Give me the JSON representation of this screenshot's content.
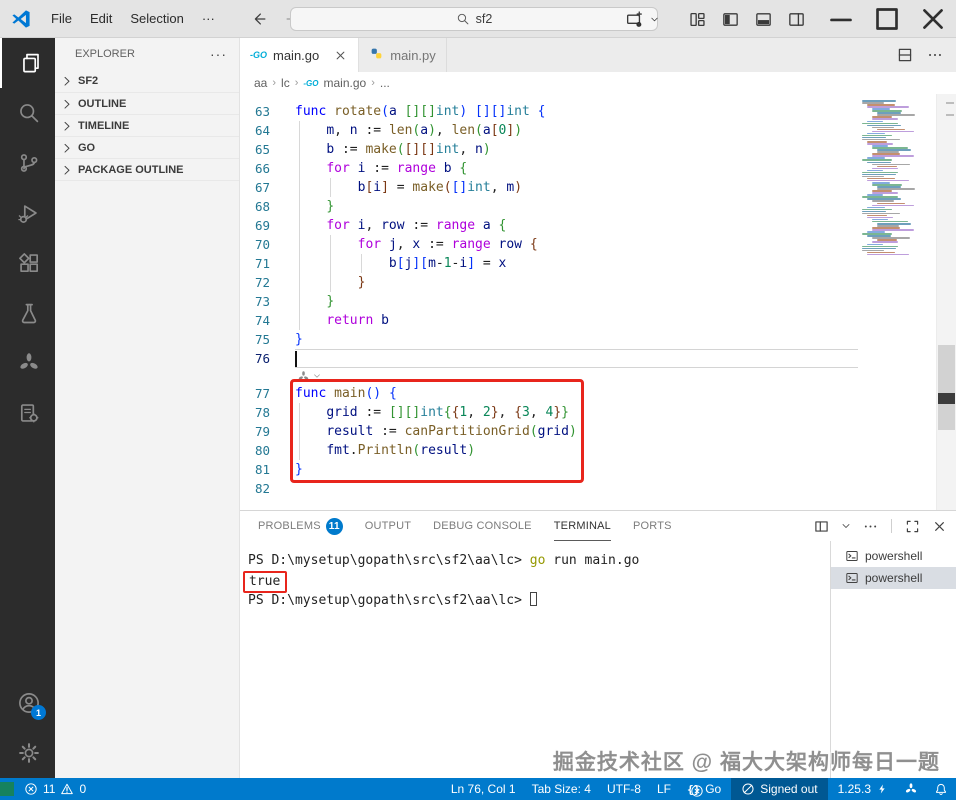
{
  "titlebar": {
    "menus": [
      "File",
      "Edit",
      "Selection",
      "···"
    ],
    "search_value": "sf2"
  },
  "activitybar": {
    "top": [
      {
        "icon": "files",
        "active": true
      },
      {
        "icon": "search",
        "active": false
      },
      {
        "icon": "source-control",
        "active": false
      },
      {
        "icon": "run-debug",
        "active": false
      },
      {
        "icon": "extensions",
        "active": false
      },
      {
        "icon": "test-flask",
        "active": false
      },
      {
        "icon": "pinwheel",
        "active": false
      },
      {
        "icon": "file-gear",
        "active": false
      }
    ],
    "bottom": [
      {
        "icon": "account",
        "badge": "1"
      },
      {
        "icon": "settings-gear"
      }
    ]
  },
  "sidebar": {
    "header": "EXPLORER",
    "more": "···",
    "sections": [
      {
        "label": "SF2"
      },
      {
        "label": "OUTLINE"
      },
      {
        "label": "TIMELINE"
      },
      {
        "label": "GO"
      },
      {
        "label": "PACKAGE OUTLINE"
      }
    ]
  },
  "tabs": [
    {
      "label": "main.go",
      "icon": "go",
      "active": true
    },
    {
      "label": "main.py",
      "icon": "python",
      "active": false
    }
  ],
  "breadcrumbs": [
    {
      "label": "aa"
    },
    {
      "label": "lc"
    },
    {
      "label": "main.go",
      "icon": "go"
    },
    {
      "label": "..."
    }
  ],
  "editor": {
    "cursor_line": 76,
    "inline_widget_after": 76,
    "annotation_lines": [
      77,
      81
    ],
    "lines": [
      {
        "n": 63,
        "toks": [
          [
            "k",
            "func "
          ],
          [
            "f",
            "rotate"
          ],
          [
            "b1",
            "("
          ],
          [
            "v",
            "a"
          ],
          [
            "p",
            " "
          ],
          [
            "b2",
            "[][]"
          ],
          [
            "t",
            "int"
          ],
          [
            "b1",
            ")"
          ],
          [
            "p",
            " "
          ],
          [
            "b1",
            "[][]"
          ],
          [
            "t",
            "int"
          ],
          [
            "p",
            " "
          ],
          [
            "b1",
            "{"
          ]
        ]
      },
      {
        "n": 64,
        "toks": [
          [
            "p",
            "    "
          ],
          [
            "v",
            "m"
          ],
          [
            "p",
            ", "
          ],
          [
            "v",
            "n"
          ],
          [
            "p",
            " := "
          ],
          [
            "f",
            "len"
          ],
          [
            "b2",
            "("
          ],
          [
            "v",
            "a"
          ],
          [
            "b2",
            ")"
          ],
          [
            "p",
            ", "
          ],
          [
            "f",
            "len"
          ],
          [
            "b2",
            "("
          ],
          [
            "v",
            "a"
          ],
          [
            "b3",
            "["
          ],
          [
            "n",
            "0"
          ],
          [
            "b3",
            "]"
          ],
          [
            "b2",
            ")"
          ]
        ]
      },
      {
        "n": 65,
        "toks": [
          [
            "p",
            "    "
          ],
          [
            "v",
            "b"
          ],
          [
            "p",
            " := "
          ],
          [
            "f",
            "make"
          ],
          [
            "b2",
            "("
          ],
          [
            "b3",
            "[][]"
          ],
          [
            "t",
            "int"
          ],
          [
            "p",
            ", "
          ],
          [
            "v",
            "n"
          ],
          [
            "b2",
            ")"
          ]
        ]
      },
      {
        "n": 66,
        "toks": [
          [
            "p",
            "    "
          ],
          [
            "c",
            "for"
          ],
          [
            "p",
            " "
          ],
          [
            "v",
            "i"
          ],
          [
            "p",
            " := "
          ],
          [
            "c",
            "range"
          ],
          [
            "p",
            " "
          ],
          [
            "v",
            "b"
          ],
          [
            "p",
            " "
          ],
          [
            "b2",
            "{"
          ]
        ]
      },
      {
        "n": 67,
        "toks": [
          [
            "p",
            "        "
          ],
          [
            "v",
            "b"
          ],
          [
            "b3",
            "["
          ],
          [
            "v",
            "i"
          ],
          [
            "b3",
            "]"
          ],
          [
            "p",
            " = "
          ],
          [
            "f",
            "make"
          ],
          [
            "b3",
            "("
          ],
          [
            "b1",
            "[]"
          ],
          [
            "t",
            "int"
          ],
          [
            "p",
            ", "
          ],
          [
            "v",
            "m"
          ],
          [
            "b3",
            ")"
          ]
        ]
      },
      {
        "n": 68,
        "toks": [
          [
            "p",
            "    "
          ],
          [
            "b2",
            "}"
          ]
        ]
      },
      {
        "n": 69,
        "toks": [
          [
            "p",
            "    "
          ],
          [
            "c",
            "for"
          ],
          [
            "p",
            " "
          ],
          [
            "v",
            "i"
          ],
          [
            "p",
            ", "
          ],
          [
            "v",
            "row"
          ],
          [
            "p",
            " := "
          ],
          [
            "c",
            "range"
          ],
          [
            "p",
            " "
          ],
          [
            "v",
            "a"
          ],
          [
            "p",
            " "
          ],
          [
            "b2",
            "{"
          ]
        ]
      },
      {
        "n": 70,
        "toks": [
          [
            "p",
            "        "
          ],
          [
            "c",
            "for"
          ],
          [
            "p",
            " "
          ],
          [
            "v",
            "j"
          ],
          [
            "p",
            ", "
          ],
          [
            "v",
            "x"
          ],
          [
            "p",
            " := "
          ],
          [
            "c",
            "range"
          ],
          [
            "p",
            " "
          ],
          [
            "v",
            "row"
          ],
          [
            "p",
            " "
          ],
          [
            "b3",
            "{"
          ]
        ]
      },
      {
        "n": 71,
        "toks": [
          [
            "p",
            "            "
          ],
          [
            "v",
            "b"
          ],
          [
            "b1",
            "["
          ],
          [
            "v",
            "j"
          ],
          [
            "b1",
            "]"
          ],
          [
            "b1",
            "["
          ],
          [
            "v",
            "m"
          ],
          [
            "p",
            "-"
          ],
          [
            "n",
            "1"
          ],
          [
            "p",
            "-"
          ],
          [
            "v",
            "i"
          ],
          [
            "b1",
            "]"
          ],
          [
            "p",
            " = "
          ],
          [
            "v",
            "x"
          ]
        ]
      },
      {
        "n": 72,
        "toks": [
          [
            "p",
            "        "
          ],
          [
            "b3",
            "}"
          ]
        ]
      },
      {
        "n": 73,
        "toks": [
          [
            "p",
            "    "
          ],
          [
            "b2",
            "}"
          ]
        ]
      },
      {
        "n": 74,
        "toks": [
          [
            "p",
            "    "
          ],
          [
            "c",
            "return"
          ],
          [
            "p",
            " "
          ],
          [
            "v",
            "b"
          ]
        ]
      },
      {
        "n": 75,
        "toks": [
          [
            "b1",
            "}"
          ]
        ]
      },
      {
        "n": 76,
        "toks": []
      },
      {
        "n": 77,
        "toks": [
          [
            "k",
            "func "
          ],
          [
            "f",
            "main"
          ],
          [
            "b1",
            "()"
          ],
          [
            "p",
            " "
          ],
          [
            "b1",
            "{"
          ]
        ]
      },
      {
        "n": 78,
        "toks": [
          [
            "p",
            "    "
          ],
          [
            "v",
            "grid"
          ],
          [
            "p",
            " := "
          ],
          [
            "b2",
            "[][]"
          ],
          [
            "t",
            "int"
          ],
          [
            "b2",
            "{"
          ],
          [
            "b3",
            "{"
          ],
          [
            "n",
            "1"
          ],
          [
            "p",
            ", "
          ],
          [
            "n",
            "2"
          ],
          [
            "b3",
            "}"
          ],
          [
            "p",
            ", "
          ],
          [
            "b3",
            "{"
          ],
          [
            "n",
            "3"
          ],
          [
            "p",
            ", "
          ],
          [
            "n",
            "4"
          ],
          [
            "b3",
            "}"
          ],
          [
            "b2",
            "}"
          ]
        ]
      },
      {
        "n": 79,
        "toks": [
          [
            "p",
            "    "
          ],
          [
            "v",
            "result"
          ],
          [
            "p",
            " := "
          ],
          [
            "f",
            "canPartitionGrid"
          ],
          [
            "b2",
            "("
          ],
          [
            "v",
            "grid"
          ],
          [
            "b2",
            ")"
          ]
        ]
      },
      {
        "n": 80,
        "toks": [
          [
            "p",
            "    "
          ],
          [
            "v",
            "fmt"
          ],
          [
            "p",
            "."
          ],
          [
            "f",
            "Println"
          ],
          [
            "b2",
            "("
          ],
          [
            "v",
            "result"
          ],
          [
            "b2",
            ")"
          ]
        ]
      },
      {
        "n": 81,
        "toks": [
          [
            "b1",
            "}"
          ]
        ]
      },
      {
        "n": 82,
        "toks": []
      }
    ]
  },
  "panel": {
    "tabs": [
      {
        "label": "PROBLEMS",
        "badge": "11"
      },
      {
        "label": "OUTPUT"
      },
      {
        "label": "DEBUG CONSOLE"
      },
      {
        "label": "TERMINAL",
        "active": true
      },
      {
        "label": "PORTS"
      }
    ],
    "terminal_lines": [
      {
        "toks": [
          [
            "p",
            "PS D:\\mysetup\\gopath\\src\\sf2\\aa\\lc> "
          ],
          [
            "cmd",
            "go"
          ],
          [
            "p",
            " run main.go"
          ]
        ]
      },
      {
        "toks": [
          [
            "boxed",
            "true"
          ]
        ]
      },
      {
        "toks": [
          [
            "p",
            "PS D:\\mysetup\\gopath\\src\\sf2\\aa\\lc> "
          ],
          [
            "cursor",
            ""
          ]
        ]
      }
    ],
    "terminal_list": [
      {
        "label": "powershell",
        "selected": false
      },
      {
        "label": "powershell",
        "selected": true
      }
    ]
  },
  "statusbar": {
    "errors": "11",
    "warnings": "0",
    "right": [
      {
        "label": "Ln 76, Col 1"
      },
      {
        "label": "Tab Size: 4"
      },
      {
        "label": "UTF-8"
      },
      {
        "label": "LF"
      },
      {
        "icon": "braces",
        "label": "Go"
      },
      {
        "icon": "copilot-off",
        "label": "Signed out",
        "dark": true
      },
      {
        "label": "1.25.3",
        "icon_after": "lightning"
      },
      {
        "icon": "pinwheel"
      },
      {
        "icon": "bell"
      }
    ]
  },
  "watermark": "掘金技术社区 @ 福大大架构师每日一题",
  "colors": {
    "accent": "#007acc",
    "remote_green": "#16825d",
    "annotation_red": "#e8251c",
    "badge_blue": "#0078d4"
  }
}
